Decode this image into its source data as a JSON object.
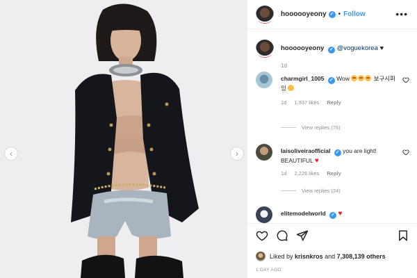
{
  "post": {
    "username": "hoooooyeony",
    "verified": true,
    "follow_label": "Follow",
    "separator": "•",
    "more_label": "•••"
  },
  "caption": {
    "username": "hoooooyeony",
    "mention": "@voguekorea",
    "suffix": "♥",
    "time": "1d"
  },
  "comments": [
    {
      "username": "charmgirl_1005",
      "verified": true,
      "text": "Wow",
      "text_after": "보구시퍼잉",
      "time": "1d",
      "likes": "1,937 likes",
      "reply_label": "Reply",
      "view_replies": "View replies (76)",
      "avatar_color": "#a8c7d6"
    },
    {
      "username": "laisoliveiraofficial",
      "verified": true,
      "text": "you are light! BEAUTIFUL",
      "time": "1d",
      "likes": "2,226 likes",
      "reply_label": "Reply",
      "view_replies": "View replies (24)",
      "avatar_color": "#4b4a3c"
    },
    {
      "username": "elitemodelworld",
      "verified": true,
      "text": "",
      "avatar_color": "#3a4256"
    }
  ],
  "actions": {
    "like_icon": "heart-outline-icon",
    "comment_icon": "speech-bubble-icon",
    "share_icon": "paper-plane-icon",
    "save_icon": "bookmark-icon"
  },
  "liked_by": {
    "prefix": "Liked by",
    "user": "krisnkros",
    "middle": "and",
    "count": "7,308,139 others"
  },
  "posted_ago": "1 DAY AGO",
  "carousel": {
    "prev_icon": "‹",
    "next_icon": "›"
  },
  "colors": {
    "accent": "#3897f0",
    "heart": "#ed1c30",
    "muted": "#8e8e8e"
  }
}
